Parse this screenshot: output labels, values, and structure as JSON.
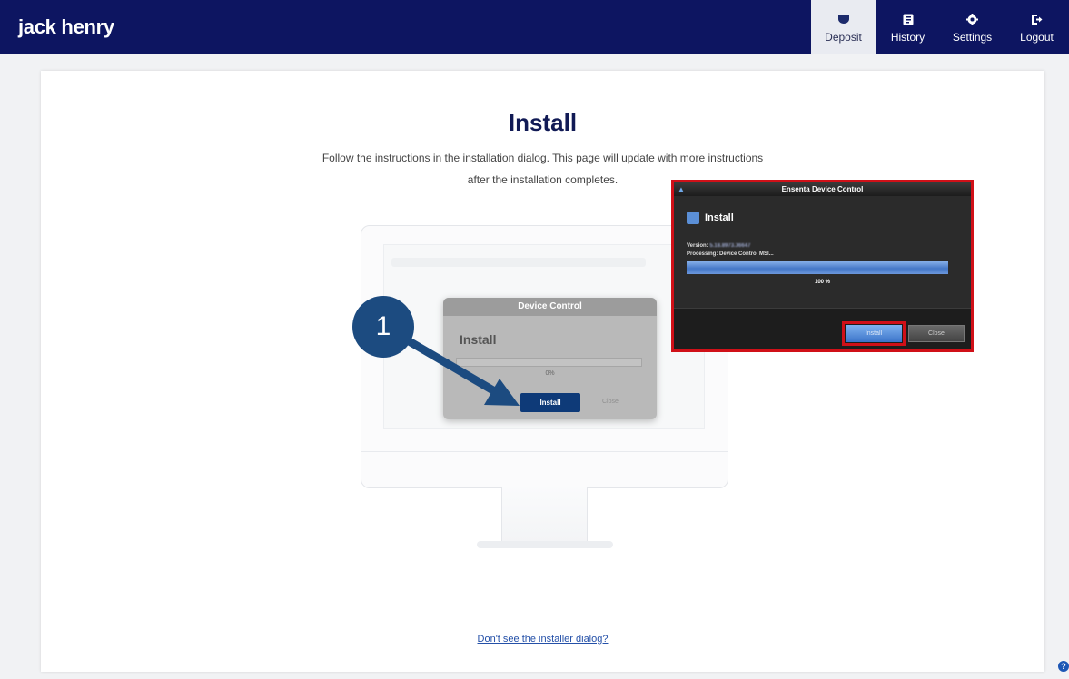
{
  "header": {
    "logo_text": "jack henry",
    "nav": [
      {
        "label": "Deposit",
        "icon": "deposit-icon",
        "active": true
      },
      {
        "label": "History",
        "icon": "history-icon",
        "active": false
      },
      {
        "label": "Settings",
        "icon": "gear-icon",
        "active": false
      },
      {
        "label": "Logout",
        "icon": "logout-icon",
        "active": false
      }
    ]
  },
  "main": {
    "title": "Install",
    "instructions": "Follow the instructions in the installation dialog. This page will update with more instructions after the installation completes.",
    "help_link": "Don't see the installer dialog?"
  },
  "illustration": {
    "step_number": "1",
    "dialog_title": "Device Control",
    "dialog_heading": "Install",
    "progress_text": "0%",
    "install_label": "Install",
    "close_label": "Close"
  },
  "installer_dialog": {
    "title": "Ensenta Device Control",
    "heading": "Install",
    "version_label": "Version:",
    "version_value": "5.18.8973.36647",
    "processing_text": "Processing: Device Control MSI...",
    "progress_text": "100 %",
    "progress": 1.0,
    "install_label": "Install",
    "close_label": "Close"
  },
  "colors": {
    "header_bg": "#0d1561",
    "active_nav_bg": "#e9ebf1",
    "accent_blue": "#1c4b80",
    "highlight_red": "#d01018"
  }
}
